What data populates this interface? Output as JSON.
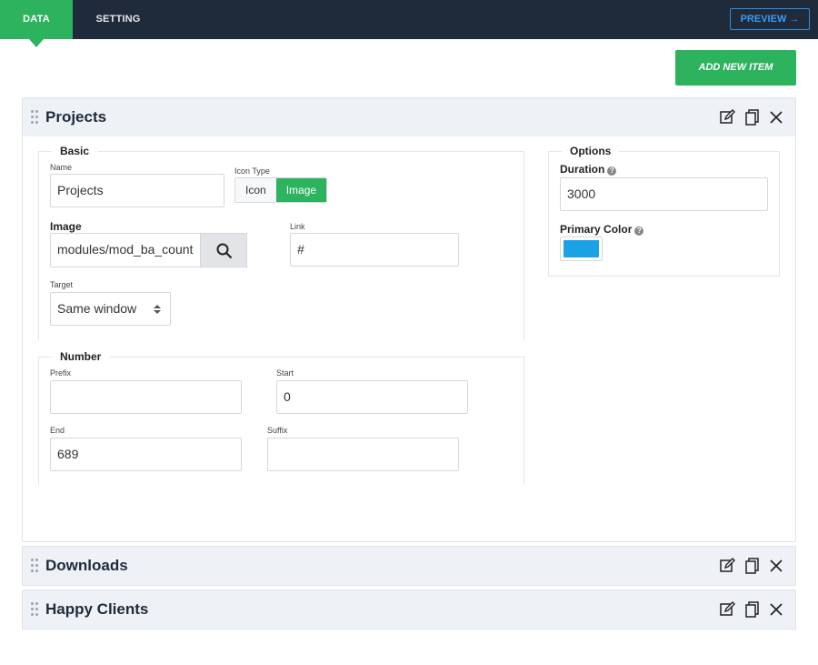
{
  "tabs": [
    {
      "label": "DATA",
      "active": true
    },
    {
      "label": "SETTING",
      "active": false
    }
  ],
  "preview_label": "PREVIEW →",
  "add_item_label": "ADD NEW ITEM",
  "colors": {
    "accent": "#2db35d",
    "topbar": "#1f2a3a",
    "preview": "#3a9bf0",
    "primary_color_value": "#1aa1e6"
  },
  "icons": {
    "drag": "drag-handle-icon",
    "edit": "edit-icon",
    "duplicate": "duplicate-icon",
    "close": "close-icon",
    "search": "search-icon",
    "help": "help-icon"
  },
  "items": [
    {
      "title": "Projects",
      "expanded": true,
      "basic": {
        "legend": "Basic",
        "name_label": "Name",
        "name_value": "Projects",
        "icon_type_label": "Icon Type",
        "icon_type_options": [
          "Icon",
          "Image"
        ],
        "icon_type_selected": "Image",
        "image_label": "Image",
        "image_value": "modules/mod_ba_count",
        "link_label": "Link",
        "link_value": "#",
        "target_label": "Target",
        "target_value": "Same window"
      },
      "number": {
        "legend": "Number",
        "prefix_label": "Prefix",
        "prefix_value": "",
        "start_label": "Start",
        "start_value": "0",
        "end_label": "End",
        "end_value": "689",
        "suffix_label": "Suffix",
        "suffix_value": ""
      },
      "options": {
        "legend": "Options",
        "duration_label": "Duration",
        "duration_value": "3000",
        "primary_color_label": "Primary Color"
      }
    },
    {
      "title": "Downloads",
      "expanded": false
    },
    {
      "title": "Happy Clients",
      "expanded": false
    }
  ]
}
